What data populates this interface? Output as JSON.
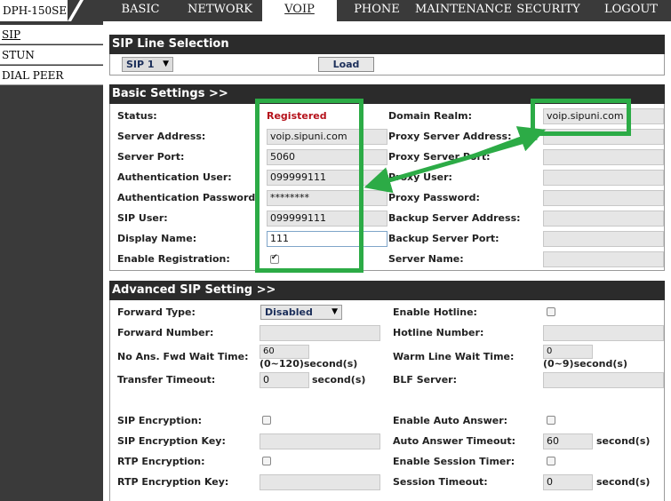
{
  "model": "DPH-150SE",
  "nav": [
    "BASIC",
    "NETWORK",
    "VOIP",
    "PHONE",
    "MAINTENANCE",
    "SECURITY",
    "LOGOUT"
  ],
  "sidebar": [
    "SIP",
    "STUN",
    "DIAL PEER"
  ],
  "sip_line": {
    "title": "SIP Line Selection",
    "select_value": "SIP 1",
    "load_label": "Load"
  },
  "basic": {
    "title": "Basic Settings >>",
    "labels": {
      "status": "Status:",
      "server_address": "Server Address:",
      "server_port": "Server Port:",
      "auth_user": "Authentication User:",
      "auth_password": "Authentication Password:",
      "sip_user": "SIP User:",
      "display_name": "Display Name:",
      "enable_registration": "Enable Registration:",
      "domain_realm": "Domain Realm:",
      "proxy_server_address": "Proxy Server Address:",
      "proxy_server_port": "Proxy Server Port:",
      "proxy_user": "Proxy User:",
      "proxy_password": "Proxy Password:",
      "backup_server_address": "Backup Server Address:",
      "backup_server_port": "Backup Server Port:",
      "server_name": "Server Name:"
    },
    "values": {
      "status": "Registered",
      "server_address": "voip.sipuni.com",
      "server_port": "5060",
      "auth_user": "099999111",
      "auth_password": "********",
      "sip_user": "099999111",
      "display_name": "111",
      "enable_registration": true,
      "domain_realm": "voip.sipuni.com"
    }
  },
  "advanced": {
    "title": "Advanced SIP Setting >>",
    "labels": {
      "forward_type": "Forward Type:",
      "forward_number": "Forward Number:",
      "no_ans_wait": "No Ans. Fwd Wait Time:",
      "transfer_timeout": "Transfer Timeout:",
      "sip_encryption": "SIP Encryption:",
      "sip_encryption_key": "SIP Encryption Key:",
      "rtp_encryption": "RTP Encryption:",
      "rtp_encryption_key": "RTP Encryption Key:",
      "enable_hotline": "Enable Hotline:",
      "hotline_number": "Hotline Number:",
      "warm_line_wait": "Warm Line Wait Time:",
      "blf_server": "BLF Server:",
      "enable_auto_answer": "Enable Auto Answer:",
      "auto_answer_timeout": "Auto Answer Timeout:",
      "enable_session_timer": "Enable Session Timer:",
      "session_timeout": "Session Timeout:"
    },
    "values": {
      "forward_type": "Disabled",
      "no_ans_wait": "60",
      "no_ans_range": "(0~120)second(s)",
      "transfer_timeout": "0",
      "warm_line_wait": "0",
      "warm_line_range": "(0~9)second(s)",
      "auto_answer_timeout": "60",
      "session_timeout": "0",
      "seconds_unit": "second(s)"
    }
  },
  "colors": {
    "bar": "#3a3a3a",
    "panel_header": "#2b2b2b",
    "status_registered": "#b5121b",
    "annotation": "#2cab46"
  }
}
